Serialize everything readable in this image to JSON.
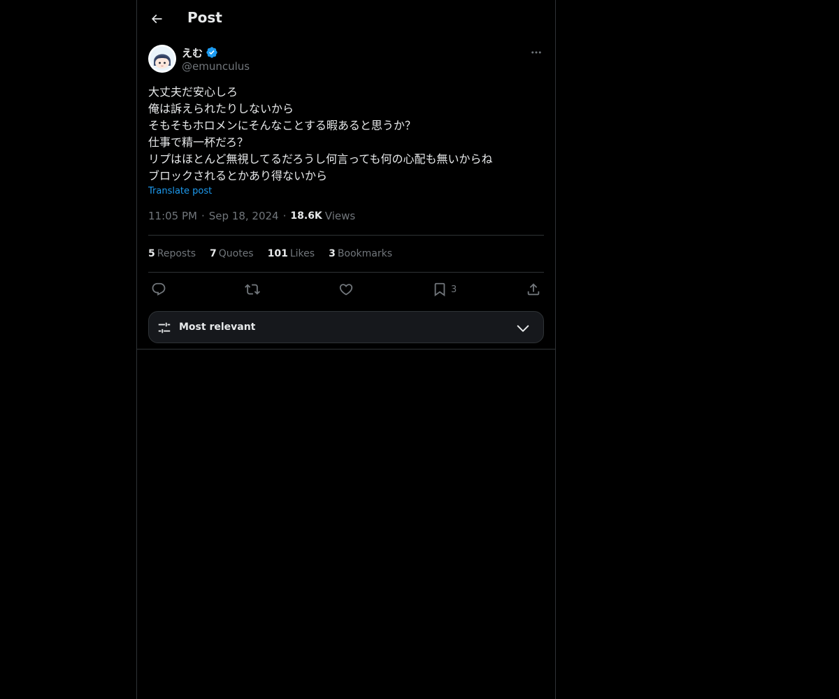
{
  "header": {
    "title": "Post"
  },
  "author": {
    "display_name": "えむ",
    "handle": "@emunculus",
    "verified": true
  },
  "post": {
    "lines": [
      "大丈夫だ安心しろ",
      "俺は訴えられたりしないから",
      "そもそもホロメンにそんなことする暇あると思うか？",
      "仕事で精一杯だろ？",
      "リプはほとんど無視してるだろうし何言っても何の心配も無いからね",
      "ブロックされるとかあり得ないから"
    ],
    "translate_label": "Translate post"
  },
  "meta": {
    "time": "11:05 PM",
    "separator": "·",
    "date": "Sep 18, 2024",
    "views_count": "18.6K",
    "views_label": "Views"
  },
  "stats": {
    "reposts": {
      "count": "5",
      "label": "Reposts"
    },
    "quotes": {
      "count": "7",
      "label": "Quotes"
    },
    "likes": {
      "count": "101",
      "label": "Likes"
    },
    "bookmarks": {
      "count": "3",
      "label": "Bookmarks"
    }
  },
  "actions": {
    "bookmark_count": "3"
  },
  "sort": {
    "label": "Most relevant"
  },
  "icons": {
    "back": "arrow-left-icon",
    "verified": "verified-badge-icon",
    "more": "more-horizontal-icon",
    "reply": "reply-icon",
    "repost": "repost-icon",
    "like": "heart-icon",
    "bookmark": "bookmark-icon",
    "share": "share-icon",
    "sort": "sliders-icon",
    "chevron": "chevron-down-icon"
  },
  "colors": {
    "accent": "#1d9bf0",
    "muted": "#71767b",
    "text": "#e7e9ea",
    "background": "#000000",
    "border": "#2f3336"
  }
}
